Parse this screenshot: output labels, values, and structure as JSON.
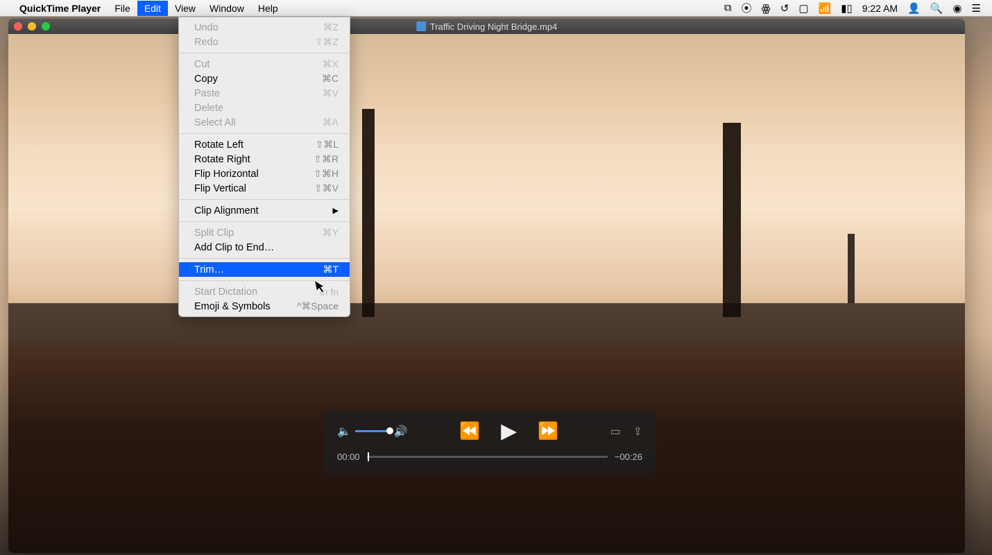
{
  "menubar": {
    "app_name": "QuickTime Player",
    "items": [
      "File",
      "Edit",
      "View",
      "Window",
      "Help"
    ],
    "active_index": 1,
    "clock": "9:22 AM"
  },
  "window": {
    "title": "Traffic Driving Night Bridge.mp4"
  },
  "player": {
    "elapsed": "00:00",
    "remaining": "−00:26"
  },
  "edit_menu": {
    "groups": [
      [
        {
          "label": "Undo",
          "shortcut": "⌘Z",
          "disabled": true
        },
        {
          "label": "Redo",
          "shortcut": "⇧⌘Z",
          "disabled": true
        }
      ],
      [
        {
          "label": "Cut",
          "shortcut": "⌘X",
          "disabled": true
        },
        {
          "label": "Copy",
          "shortcut": "⌘C",
          "disabled": false
        },
        {
          "label": "Paste",
          "shortcut": "⌘V",
          "disabled": true
        },
        {
          "label": "Delete",
          "shortcut": "",
          "disabled": true
        },
        {
          "label": "Select All",
          "shortcut": "⌘A",
          "disabled": true
        }
      ],
      [
        {
          "label": "Rotate Left",
          "shortcut": "⇧⌘L",
          "disabled": false
        },
        {
          "label": "Rotate Right",
          "shortcut": "⇧⌘R",
          "disabled": false
        },
        {
          "label": "Flip Horizontal",
          "shortcut": "⇧⌘H",
          "disabled": false
        },
        {
          "label": "Flip Vertical",
          "shortcut": "⇧⌘V",
          "disabled": false
        }
      ],
      [
        {
          "label": "Clip Alignment",
          "shortcut": "",
          "disabled": false,
          "submenu": true
        }
      ],
      [
        {
          "label": "Split Clip",
          "shortcut": "⌘Y",
          "disabled": true
        },
        {
          "label": "Add Clip to End…",
          "shortcut": "",
          "disabled": false
        }
      ],
      [
        {
          "label": "Trim…",
          "shortcut": "⌘T",
          "disabled": false,
          "highlighted": true
        }
      ],
      [
        {
          "label": "Start Dictation",
          "shortcut": "fn fn",
          "disabled": true
        },
        {
          "label": "Emoji & Symbols",
          "shortcut": "^⌘Space",
          "disabled": false
        }
      ]
    ]
  }
}
